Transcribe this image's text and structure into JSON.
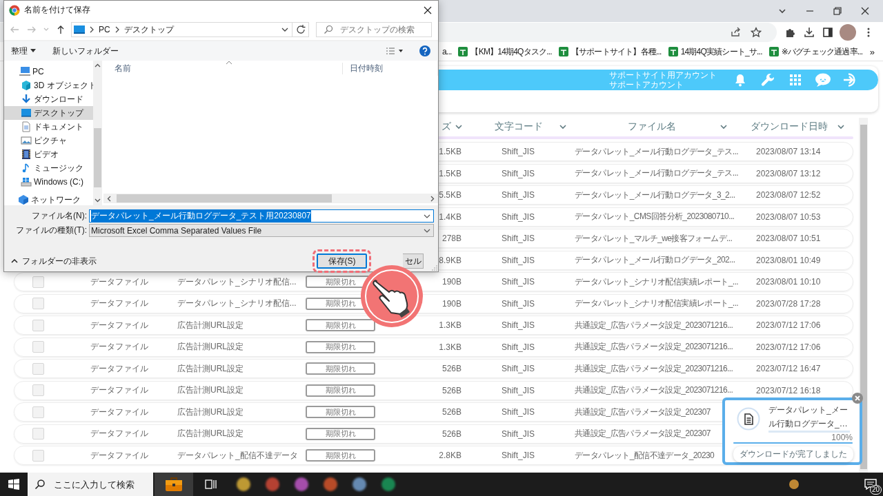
{
  "browser": {
    "bookmarks": [
      {
        "kind": "plain",
        "label": "a..."
      },
      {
        "kind": "sheet",
        "label": "【KM】14期4Qタスク..."
      },
      {
        "kind": "sheet",
        "label": "【サポートサイト】各種..."
      },
      {
        "kind": "sheet",
        "label": "14期4Q実績シート_サ..."
      },
      {
        "kind": "sheet",
        "label": "※バグチェック通過率..."
      }
    ],
    "bookmarks_more": "»"
  },
  "app_header": {
    "account_name": "サポートサイト用アカウント",
    "account_type": "サポートアカウント"
  },
  "table": {
    "columns": [
      {
        "label": "ズ"
      },
      {
        "label": "文字コード"
      },
      {
        "label": "ファイル名"
      },
      {
        "label": "ダウンロード日時"
      }
    ],
    "rows": [
      {
        "kind": "partial",
        "size": "1.5KB",
        "encoding": "Shift_JIS",
        "file_name": "データパレット_メール行動ログデータ_テス...",
        "downloaded_at": "2023/08/07 13:14"
      },
      {
        "kind": "partial",
        "size": "1.5KB",
        "encoding": "Shift_JIS",
        "file_name": "データパレット_メール行動ログデータ_テス...",
        "downloaded_at": "2023/08/07 13:12"
      },
      {
        "kind": "partial",
        "size": "5.5KB",
        "encoding": "Shift_JIS",
        "file_name": "データパレット_メール行動ログデータ_3_2...",
        "downloaded_at": "2023/08/07 12:52"
      },
      {
        "kind": "partial",
        "size": "1.4KB",
        "encoding": "Shift_JIS",
        "file_name": "データパレット_CMS回答分析_2023080710...",
        "downloaded_at": "2023/08/07 10:53"
      },
      {
        "kind": "partial",
        "size": "278B",
        "encoding": "Shift_JIS",
        "file_name": "データパレット_マルチ_we接客フォームデ...",
        "downloaded_at": "2023/08/07 10:51"
      },
      {
        "kind": "partial",
        "size": "8.9KB",
        "encoding": "Shift_JIS",
        "file_name": "データパレット_メール行動ログデータ_202...",
        "downloaded_at": "2023/08/01 10:49"
      },
      {
        "kind": "full",
        "checked": false,
        "type": "データファイル",
        "name": "データパレット_シナリオ配信...",
        "status": "期限切れ",
        "size": "190B",
        "encoding": "Shift_JIS",
        "file_name": "データパレット_シナリオ配信実績レポート_...",
        "downloaded_at": "2023/08/01 10:10"
      },
      {
        "kind": "full",
        "checked": false,
        "type": "データファイル",
        "name": "データパレット_シナリオ配信...",
        "status": "期限切れ",
        "size": "190B",
        "encoding": "Shift_JIS",
        "file_name": "データパレット_シナリオ配信実績レポート_...",
        "downloaded_at": "2023/07/28 17:28"
      },
      {
        "kind": "full",
        "checked": false,
        "type": "データファイル",
        "name": "広告計測URL設定",
        "status": "期限切れ",
        "size": "1.3KB",
        "encoding": "Shift_JIS",
        "file_name": "共通設定_広告パラメータ設定_2023071216...",
        "downloaded_at": "2023/07/12 17:06"
      },
      {
        "kind": "full",
        "checked": false,
        "type": "データファイル",
        "name": "広告計測URL設定",
        "status": "期限切れ",
        "size": "1.3KB",
        "encoding": "Shift_JIS",
        "file_name": "共通設定_広告パラメータ設定_2023071216...",
        "downloaded_at": "2023/07/12 17:06"
      },
      {
        "kind": "full",
        "checked": false,
        "type": "データファイル",
        "name": "広告計測URL設定",
        "status": "期限切れ",
        "size": "526B",
        "encoding": "Shift_JIS",
        "file_name": "共通設定_広告パラメータ設定_2023071216...",
        "downloaded_at": "2023/07/12 16:47"
      },
      {
        "kind": "full",
        "checked": false,
        "type": "データファイル",
        "name": "広告計測URL設定",
        "status": "期限切れ",
        "size": "526B",
        "encoding": "Shift_JIS",
        "file_name": "共通設定_広告パラメータ設定_2023071216...",
        "downloaded_at": "2023/07/12 16:18"
      },
      {
        "kind": "full",
        "checked": false,
        "type": "データファイル",
        "name": "広告計測URL設定",
        "status": "期限切れ",
        "size": "526B",
        "encoding": "Shift_JIS",
        "file_name": "共通設定_広告パラメータ設定_202307"
      },
      {
        "kind": "full",
        "checked": false,
        "type": "データファイル",
        "name": "広告計測URL設定",
        "status": "期限切れ",
        "size": "526B",
        "encoding": "Shift_JIS",
        "file_name": "共通設定_広告パラメータ設定_202307"
      },
      {
        "kind": "full",
        "checked": false,
        "type": "データファイル",
        "name": "データパレット_配信不達データ",
        "status": "期限切れ",
        "size": "2.8KB",
        "encoding": "Shift_JIS",
        "file_name": "データパレット_配信不達データ_20230"
      }
    ]
  },
  "dialog": {
    "title": "名前を付けて保存",
    "path": [
      "PC",
      "デスクトップ"
    ],
    "search": {
      "placeholder": "デスクトップの検索"
    },
    "toolbar": {
      "organize": "整理",
      "new_folder": "新しいフォルダー"
    },
    "nav_tree": [
      {
        "label": "PC",
        "kind": "pc",
        "selected": false,
        "children": [
          {
            "label": "3D オブジェクト",
            "kind": "cube",
            "selected": false
          },
          {
            "label": "ダウンロード",
            "kind": "download",
            "selected": false
          },
          {
            "label": "デスクトップ",
            "kind": "desktop",
            "selected": true
          },
          {
            "label": "ドキュメント",
            "kind": "document",
            "selected": false
          },
          {
            "label": "ピクチャ",
            "kind": "picture",
            "selected": false
          },
          {
            "label": "ビデオ",
            "kind": "video",
            "selected": false
          },
          {
            "label": "ミュージック",
            "kind": "music",
            "selected": false
          },
          {
            "label": "Windows (C:)",
            "kind": "drive",
            "selected": false
          }
        ]
      },
      {
        "label": "ネットワーク",
        "kind": "network",
        "selected": false
      }
    ],
    "columns": [
      {
        "label": "名前"
      },
      {
        "label": "日付時刻"
      }
    ],
    "file_name": {
      "label": "ファイル名(N):",
      "value": "データパレット_メール行動ログデータ_テスト用20230807",
      "text_selected": true
    },
    "file_type": {
      "label": "ファイルの種類(T):",
      "value": "Microsoft Excel Comma Separated Values File"
    },
    "hide_folders": "フォルダーの非表示",
    "buttons": [
      {
        "label": "保存(S)",
        "kind": "primary",
        "highlighted": true
      },
      {
        "label": "セル",
        "kind": "secondary",
        "highlighted": false
      }
    ]
  },
  "download_toast": {
    "file_name": "データパレット_メール行動ログデータ_…",
    "level": 1,
    "percent": "100%",
    "status": "ダウンロードが完了しました"
  },
  "taskbar": {
    "search": {
      "placeholder": "ここに入力して検索"
    },
    "notification_count": "20"
  }
}
